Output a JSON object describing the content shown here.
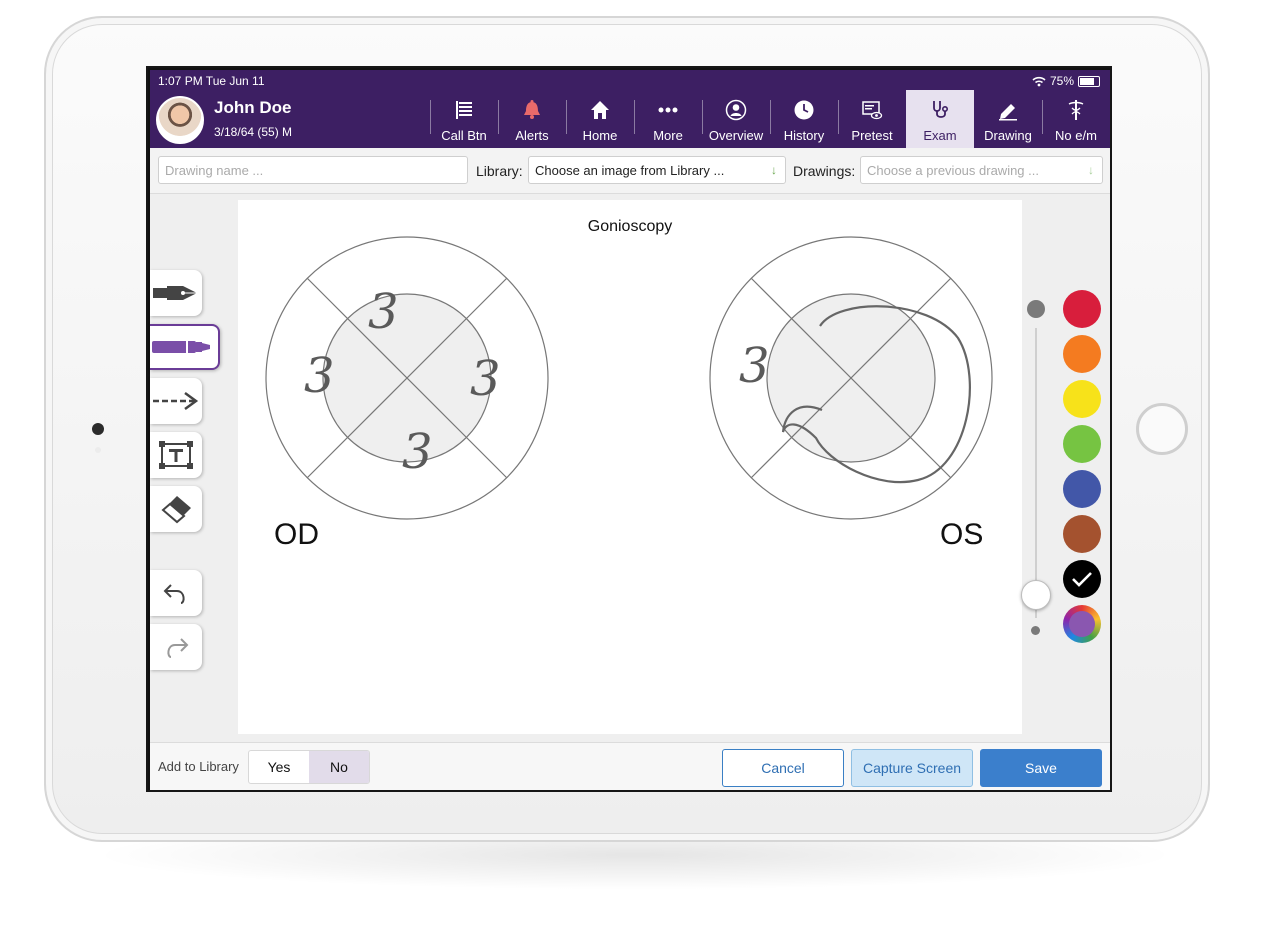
{
  "status": {
    "time_date": "1:07 PM   Tue Jun 11",
    "battery": "75%"
  },
  "patient": {
    "name": "John Doe",
    "dob_age_sex": "3/18/64 (55) M"
  },
  "nav": [
    {
      "label": "Call Btn",
      "icon": "list-icon"
    },
    {
      "label": "Alerts",
      "icon": "bell-icon"
    },
    {
      "label": "Home",
      "icon": "home-icon"
    },
    {
      "label": "More",
      "icon": "more-icon"
    },
    {
      "label": "Overview",
      "icon": "person-icon"
    },
    {
      "label": "History",
      "icon": "clock-icon"
    },
    {
      "label": "Pretest",
      "icon": "screen-eye-icon"
    },
    {
      "label": "Exam",
      "icon": "stethoscope-icon",
      "active": true
    },
    {
      "label": "Drawing",
      "icon": "pencil-icon"
    },
    {
      "label": "No e/m",
      "icon": "caduceus-icon"
    }
  ],
  "toolbar": {
    "drawing_name_placeholder": "Drawing name ...",
    "library_label": "Library:",
    "library_value": "Choose an image from Library ...",
    "drawings_label": "Drawings:",
    "drawings_value": "Choose a previous drawing ..."
  },
  "canvas": {
    "title": "Gonioscopy",
    "od_label": "OD",
    "os_label": "OS",
    "od_marks": [
      "3",
      "3",
      "3",
      "3"
    ],
    "os_marks": [
      "3"
    ]
  },
  "tools": [
    "pen-tool-icon",
    "marker-tool-icon",
    "arrow-tool-icon",
    "text-tool-icon",
    "eraser-tool-icon",
    "undo-icon",
    "redo-icon"
  ],
  "colors": {
    "swatches": [
      "#d81e3c",
      "#f47b20",
      "#f7e21a",
      "#76c442",
      "#4257a8",
      "#a4522f",
      "#000000",
      "#8a57b0"
    ],
    "selected": "#000000",
    "header_bg": "#3d1f63"
  },
  "footer": {
    "add_to_library": "Add to Library",
    "yes": "Yes",
    "no": "No",
    "cancel": "Cancel",
    "capture": "Capture Screen",
    "save": "Save"
  }
}
